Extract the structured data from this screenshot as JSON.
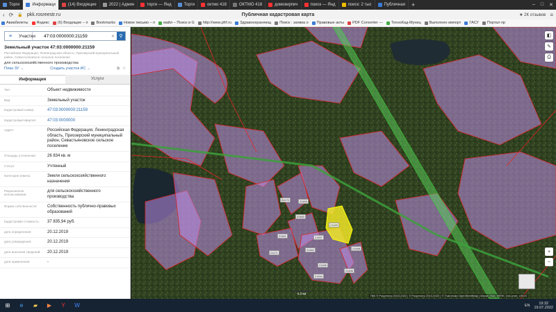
{
  "browser": {
    "tabs": [
      {
        "label": "Торги",
        "color": "#5a8fd8"
      },
      {
        "label": "Информаци",
        "color": "#3a7bd5",
        "active": true
      },
      {
        "label": "(14) Входящие",
        "color": "#d44"
      },
      {
        "label": "2022 | Админ",
        "color": "#999"
      },
      {
        "label": "торги — Янд",
        "color": "#f33"
      },
      {
        "label": "Торги",
        "color": "#5a8fd8"
      },
      {
        "label": "октмо 418",
        "color": "#f33"
      },
      {
        "label": "ОКТМО 418",
        "color": "#777"
      },
      {
        "label": "домокирпич",
        "color": "#f33"
      },
      {
        "label": "поиск — Янд",
        "color": "#f33"
      },
      {
        "label": "поиск: 2 тыс",
        "color": "#eb0"
      },
      {
        "label": "Публичная",
        "color": "#3a7bd5"
      }
    ],
    "tab_add": "+",
    "url": "pkk.rosreestr.ru",
    "page_title": "Публичная кадастровая карта",
    "reviews": "★ 2К отзывов",
    "bookmarks": [
      {
        "label": "Авиабилеты",
        "color": "#3a7bd5"
      },
      {
        "label": "Яндекс",
        "color": "#f33"
      },
      {
        "label": "(6) Входящие – п",
        "color": "#d44"
      },
      {
        "label": "Bookmarks",
        "color": "#777"
      },
      {
        "label": "Новое письмо – п",
        "color": "#3a7bd5"
      },
      {
        "label": "майл – Поиск в G",
        "color": "#4a4"
      },
      {
        "label": "http://www.pfrf.ru",
        "color": "#777"
      },
      {
        "label": "Здравоохраняющ",
        "color": "#3a7bd5"
      },
      {
        "label": "Поиск : заявка о",
        "color": "#777"
      },
      {
        "label": "Правовые акты",
        "color": "#3a7bd5"
      },
      {
        "label": "PDF Converter —",
        "color": "#d44"
      },
      {
        "label": "ТехноКад-Муниц",
        "color": "#4a4"
      },
      {
        "label": "Выполнен импорт",
        "color": "#777"
      },
      {
        "label": "ГАСУ",
        "color": "#3a7bd5"
      },
      {
        "label": "Портал пр",
        "color": "#777"
      }
    ]
  },
  "search": {
    "type_label": "Участки",
    "query": "47:03:0000000:21159"
  },
  "object": {
    "title": "Земельный участок 47:03:0000000:21159",
    "address_small": "Российская Федерация, Ленинградская область, Приозерский муниципальный район, Севастьяновское сельское поселение",
    "use_small": "для сельскохозяйственного производства",
    "link_plan": "План ЗУ →",
    "link_create": "Создать участок ИС →",
    "tab_info": "Информация",
    "tab_services": "Услуги"
  },
  "properties": [
    {
      "k": "Тип:",
      "v": "Объект недвижимости",
      "link": false
    },
    {
      "k": "Вид:",
      "v": "Земельный участок",
      "link": false
    },
    {
      "k": "Кадастровый номер:",
      "v": "47:03:0000000:21159",
      "link": true
    },
    {
      "k": "Кадастровый квартал:",
      "v": "47:03:0000000",
      "link": true
    },
    {
      "k": "Адрес:",
      "v": "Российская Федерация, Ленинградская область, Приозерский муниципальный район, Севастьяновское сельское поселение",
      "link": false
    },
    {
      "k": "Площадь уточненная:",
      "v": "26 834 кв. м",
      "link": false
    },
    {
      "k": "Статус:",
      "v": "Учтенный",
      "link": false
    },
    {
      "k": "Категория земель:",
      "v": "Земли сельскохозяйственного назначения",
      "link": false
    },
    {
      "k": "Разрешенное использование:",
      "v": "для сельскохозяйственного производства",
      "link": false
    },
    {
      "k": "Форма собственности:",
      "v": "Собственность публично-правовых образований",
      "link": false
    },
    {
      "k": "Кадастровая стоимость:",
      "v": "37 835,94 руб.",
      "link": false
    },
    {
      "k": "дата определения:",
      "v": "20.12.2019",
      "link": false
    },
    {
      "k": "дата утверждения:",
      "v": "20.12.2019",
      "link": false
    },
    {
      "k": "дата внесения сведений:",
      "v": "20.12.2019",
      "link": false
    },
    {
      "k": "дата применения:",
      "v": "-",
      "link": false
    }
  ],
  "map": {
    "labels": [
      {
        "t": "21159"
      },
      {
        "t": "21160"
      },
      {
        "t": "21161"
      },
      {
        "t": "21162"
      },
      {
        "t": "21155"
      },
      {
        "t": "21156"
      },
      {
        "t": "21157"
      },
      {
        "t": "21158"
      },
      {
        "t": "21154"
      },
      {
        "t": "21170"
      },
      {
        "t": "21163"
      },
      {
        "t": "21171"
      }
    ],
    "scale": "0.3 км",
    "copyright": "ПКК © Росреестр 2010-2022 | © Росреестр 2010-2022 | © Участники OpenStreetMap | Maxar | Esri, HERE, DeLorme, USGS",
    "zoom_in": "+",
    "zoom_out": "−"
  },
  "taskbar": {
    "lang": "EN",
    "time": "19:32",
    "date": "19.07.2022"
  }
}
